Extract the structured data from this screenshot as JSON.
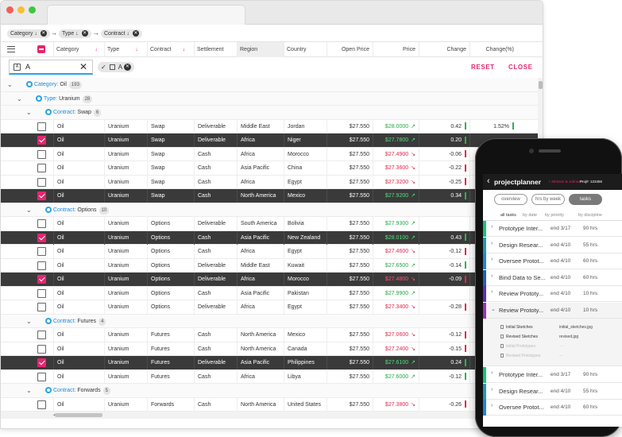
{
  "group_chips": [
    {
      "label": "Category",
      "arrow": "↓"
    },
    {
      "label": "Type",
      "arrow": "↓"
    },
    {
      "label": "Contract",
      "arrow": "↓"
    }
  ],
  "columns": {
    "category": "Category",
    "type": "Type",
    "contract": "Contract",
    "settlement": "Settlement",
    "region": "Region",
    "country": "Country",
    "open_price": "Open Price",
    "price": "Price",
    "change": "Change",
    "change_pct": "Change(%)"
  },
  "sort_arrow": "↓",
  "filter": {
    "search_value": "A",
    "chip_value": "A",
    "search_icon_text": "A",
    "reset": "RESET",
    "close": "CLOSE"
  },
  "colors": {
    "accent": "#e5266f",
    "group": "#29a3e5",
    "up": "#22a845",
    "down": "#e5264b",
    "selected_row": "#3a3a3a"
  },
  "groups": [
    {
      "kind": "group",
      "level": 0,
      "key": "Category:",
      "value": "Oil",
      "count": "193"
    },
    {
      "kind": "group",
      "level": 1,
      "key": "Type:",
      "value": "Uranium",
      "count": "28"
    },
    {
      "kind": "group",
      "level": 2,
      "key": "Contract:",
      "value": "Swap",
      "count": "6"
    },
    {
      "kind": "row",
      "sel": false,
      "cells": [
        "Oil",
        "Uranium",
        "Swap",
        "Deliverable",
        "Middle East",
        "Jordan",
        "$27.550",
        "$28.0000",
        "0.42",
        "1.52%"
      ],
      "dir": "up"
    },
    {
      "kind": "row",
      "sel": true,
      "cells": [
        "Oil",
        "Uranium",
        "Swap",
        "Deliverable",
        "Africa",
        "Niger",
        "$27.550",
        "$27.7800",
        "0.20",
        ""
      ],
      "dir": "up"
    },
    {
      "kind": "row",
      "sel": false,
      "cells": [
        "Oil",
        "Uranium",
        "Swap",
        "Cash",
        "Africa",
        "Morocco",
        "$27.550",
        "$27.4900",
        "-0.06",
        ""
      ],
      "dir": "down"
    },
    {
      "kind": "row",
      "sel": false,
      "cells": [
        "Oil",
        "Uranium",
        "Swap",
        "Cash",
        "Asia Pacific",
        "China",
        "$27.550",
        "$27.3600",
        "-0.22",
        ""
      ],
      "dir": "down"
    },
    {
      "kind": "row",
      "sel": false,
      "cells": [
        "Oil",
        "Uranium",
        "Swap",
        "Cash",
        "Africa",
        "Egypt",
        "$27.550",
        "$27.3200",
        "-0.25",
        ""
      ],
      "dir": "down"
    },
    {
      "kind": "row",
      "sel": true,
      "cells": [
        "Oil",
        "Uranium",
        "Swap",
        "Cash",
        "North America",
        "Mexico",
        "$27.550",
        "$27.9200",
        "0.34",
        ""
      ],
      "dir": "up"
    },
    {
      "kind": "group",
      "level": 2,
      "key": "Contract:",
      "value": "Options",
      "count": "10"
    },
    {
      "kind": "row",
      "sel": false,
      "cells": [
        "Oil",
        "Uranium",
        "Options",
        "Deliverable",
        "South America",
        "Bolivia",
        "$27.550",
        "$27.9300",
        "",
        ""
      ],
      "dir": "up"
    },
    {
      "kind": "row",
      "sel": true,
      "cells": [
        "Oil",
        "Uranium",
        "Options",
        "Cash",
        "Asia Pacific",
        "New Zealand",
        "$27.550",
        "$28.0100",
        "0.43",
        ""
      ],
      "dir": "up"
    },
    {
      "kind": "row",
      "sel": false,
      "cells": [
        "Oil",
        "Uranium",
        "Options",
        "Cash",
        "Africa",
        "Egypt",
        "$27.550",
        "$27.4600",
        "-0.12",
        ""
      ],
      "dir": "down"
    },
    {
      "kind": "row",
      "sel": false,
      "cells": [
        "Oil",
        "Uranium",
        "Options",
        "Deliverable",
        "Middle East",
        "Kuwait",
        "$27.550",
        "$27.6500",
        "-0.14",
        ""
      ],
      "dir": "up"
    },
    {
      "kind": "row",
      "sel": true,
      "cells": [
        "Oil",
        "Uranium",
        "Options",
        "Deliverable",
        "Africa",
        "Morocco",
        "$27.550",
        "$27.4800",
        "-0.09",
        ""
      ],
      "dir": "down"
    },
    {
      "kind": "row",
      "sel": false,
      "cells": [
        "Oil",
        "Uranium",
        "Options",
        "Cash",
        "Asia Pacific",
        "Pakistan",
        "$27.550",
        "$27.9900",
        "",
        ""
      ],
      "dir": "up"
    },
    {
      "kind": "row",
      "sel": false,
      "cells": [
        "Oil",
        "Uranium",
        "Options",
        "Deliverable",
        "Africa",
        "Egypt",
        "$27.550",
        "$27.3400",
        "-0.28",
        ""
      ],
      "dir": "down"
    },
    {
      "kind": "group",
      "level": 2,
      "key": "Contract:",
      "value": "Futures",
      "count": "4"
    },
    {
      "kind": "row",
      "sel": false,
      "cells": [
        "Oil",
        "Uranium",
        "Futures",
        "Cash",
        "North America",
        "Mexico",
        "$27.550",
        "$27.0600",
        "-0.12",
        ""
      ],
      "dir": "down"
    },
    {
      "kind": "row",
      "sel": false,
      "cells": [
        "Oil",
        "Uranium",
        "Futures",
        "Cash",
        "North America",
        "Canada",
        "$27.550",
        "$27.2400",
        "-0.15",
        ""
      ],
      "dir": "down"
    },
    {
      "kind": "row",
      "sel": true,
      "cells": [
        "Oil",
        "Uranium",
        "Futures",
        "Deliverable",
        "Asia Pacific",
        "Philippines",
        "$27.550",
        "$27.6100",
        "0.24",
        ""
      ],
      "dir": "up"
    },
    {
      "kind": "row",
      "sel": false,
      "cells": [
        "Oil",
        "Uranium",
        "Futures",
        "Cash",
        "Africa",
        "Libya",
        "$27.550",
        "$27.6000",
        "-0.12",
        ""
      ],
      "dir": "up"
    },
    {
      "kind": "group",
      "level": 2,
      "key": "Contract:",
      "value": "Forwards",
      "count": "5"
    },
    {
      "kind": "row",
      "sel": false,
      "cells": [
        "Oil",
        "Uranium",
        "Forwards",
        "Cash",
        "North America",
        "United States",
        "$27.550",
        "$27.3800",
        "-0.26",
        ""
      ],
      "dir": "down"
    }
  ],
  "phone": {
    "brand": "projectplanner",
    "client": "/ Johnson & Johnson",
    "project": "Proj#: 123456",
    "segments": [
      "overview",
      "hrs by week",
      "tasks"
    ],
    "subtabs": [
      "all tasks",
      "by date",
      "by priority",
      "by discipline"
    ],
    "tasks": [
      {
        "name": "Prototype Inter...",
        "end": "end  3/17",
        "hrs": "90 hrs",
        "color": "#19c27a",
        "chev": "›"
      },
      {
        "name": "Design Resear...",
        "end": "end  4/10",
        "hrs": "55 hrs",
        "color": "#1f9bb0",
        "chev": "›"
      },
      {
        "name": "Oversee Protot...",
        "end": "end  4/10",
        "hrs": "60 hrs",
        "color": "#1e88d8",
        "chev": "›"
      },
      {
        "name": "Bind Data to Se...",
        "end": "end  4/10",
        "hrs": "60 hrs",
        "color": "#1e5fc8",
        "chev": "›"
      },
      {
        "name": "Review Prototy...",
        "end": "end  4/10",
        "hrs": "10 hrs",
        "color": "#5b2fc0",
        "chev": "›"
      },
      {
        "name": "Review Prototy...",
        "end": "end  4/10",
        "hrs": "10 hrs",
        "color": "#9b2fc6",
        "chev": "⌄"
      }
    ],
    "details": [
      {
        "label": "Initial Sketches",
        "file": "initial_sketches.jpg",
        "faded": false
      },
      {
        "label": "Revised Sketches",
        "file": "revised.jpg",
        "faded": false
      },
      {
        "label": "Initial Prototypes",
        "file": "—",
        "faded": true
      },
      {
        "label": "Revised Prototypes",
        "file": "—",
        "faded": true
      }
    ],
    "tasks_after": [
      {
        "name": "Prototype Inter...",
        "end": "end  3/17",
        "hrs": "90 hrs",
        "color": "#19c27a",
        "chev": "›"
      },
      {
        "name": "Design Resear...",
        "end": "end  4/10",
        "hrs": "55 hrs",
        "color": "#1f9bb0",
        "chev": "›"
      },
      {
        "name": "Oversee Protot...",
        "end": "end  4/10",
        "hrs": "60 hrs",
        "color": "#1e88d8",
        "chev": "›"
      }
    ]
  }
}
